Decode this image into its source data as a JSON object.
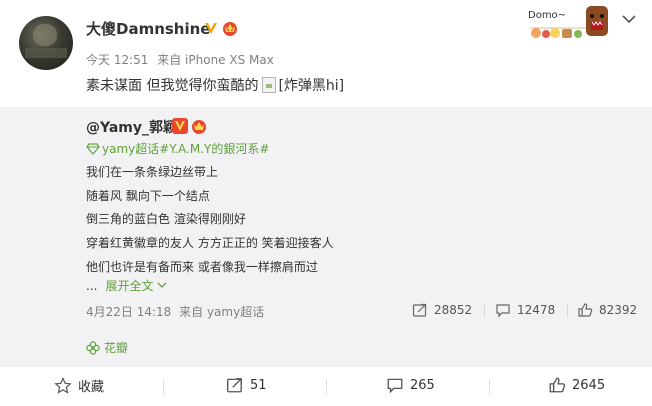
{
  "post": {
    "author": "大傻Damnshine",
    "time": "今天 12:51",
    "source": "来自 iPhone XS Max",
    "text": "素未谋面 但我觉得你蛮酷的",
    "emote_text": "[炸弹黑hi]",
    "deco_text": "Domo~"
  },
  "repost": {
    "author": "@Yamy_郭颖",
    "topic": "yamy超话#Y.A.M.Y的銀河系#",
    "lines": [
      "我们在一条条绿边丝带上",
      "随着风 飘向下一个结点",
      "倒三角的蓝白色 渲染得刚刚好",
      "穿着红黄徽章的友人 方方正正的 笑着迎接客人",
      "他们也许是有备而来 或者像我一样擦肩而过"
    ],
    "ellipsis": "...",
    "expand_label": "展开全文",
    "date": "4月22日 14:18",
    "source": "来自 yamy超话",
    "stats": {
      "reposts": "28852",
      "comments": "12478",
      "likes": "82392"
    },
    "tag": "花瓣"
  },
  "actions": {
    "favorite_label": "收藏",
    "reposts": "51",
    "comments": "265",
    "likes": "2645"
  },
  "colors": {
    "accent_green": "#5fa13a",
    "repost_bg": "#f2f2f5",
    "verified_orange": "#f7a400",
    "member_red": "#e6482e"
  },
  "icons": {
    "verified": "verified-v-icon",
    "member": "member-crown-icon",
    "chevron": "chevron-down-icon",
    "topic": "diamond-topic-icon",
    "repost": "repost-icon",
    "comment": "comment-icon",
    "like": "thumbs-up-icon",
    "favorite": "star-icon",
    "tag": "flower-icon"
  }
}
